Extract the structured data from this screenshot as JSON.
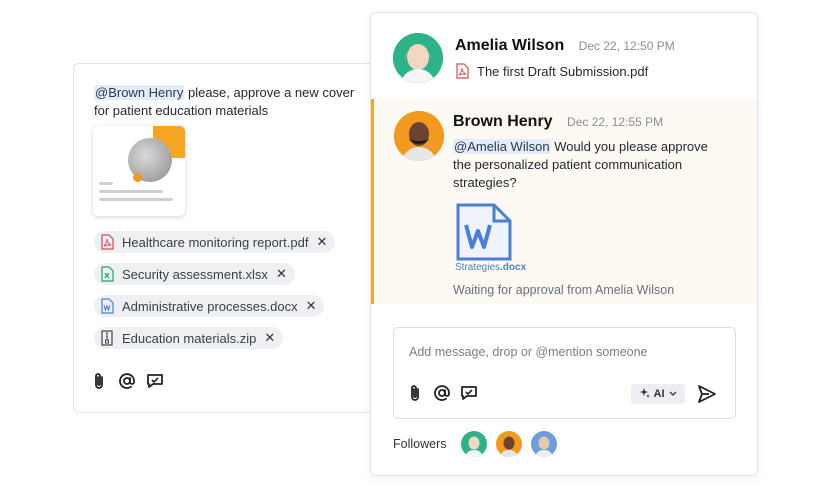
{
  "compose": {
    "mention": "@Brown Henry",
    "text": "please, approve a new cover for patient education materials",
    "attachments": [
      {
        "name": "Healthcare monitoring report.pdf",
        "icon": "pdf-icon",
        "color": "#e0474c"
      },
      {
        "name": "Security assessment.xlsx",
        "icon": "excel-icon",
        "color": "#21a366"
      },
      {
        "name": "Administrative processes.docx",
        "icon": "word-icon",
        "color": "#4a7ed8"
      },
      {
        "name": "Education materials.zip",
        "icon": "zip-icon",
        "color": "#555555"
      }
    ],
    "remove_glyph": "✕",
    "tools": [
      "paperclip-icon",
      "at-icon",
      "comment-icon"
    ]
  },
  "thread": {
    "message1": {
      "author": "Amelia Wilson",
      "time": "Dec 22, 12:50 PM",
      "file": "The first Draft Submission.pdf"
    },
    "message2": {
      "author": "Brown Henry",
      "time": "Dec 22, 12:55 PM",
      "mention": "@Amelia Wilson",
      "text": "Would you please approve the personalized patient communication strategies?",
      "attachment_name": "Strategies",
      "attachment_ext": ".docx",
      "status": "Waiting for approval from Amelia Wilson"
    },
    "composer": {
      "placeholder": "Add message, drop or @mention someone",
      "ai_label": "AI",
      "tools": [
        "paperclip-icon",
        "at-icon",
        "comment-icon"
      ]
    },
    "followers": {
      "label": "Followers",
      "count": 3
    }
  },
  "colors": {
    "accent": "#f5a623",
    "mention_bg": "#e4ecf8",
    "word_blue": "#4a7ed8",
    "pdf_red": "#e0474c",
    "avatar_green": "#2db38a",
    "avatar_orange": "#f39a1e",
    "avatar_blue": "#6c9de0"
  }
}
